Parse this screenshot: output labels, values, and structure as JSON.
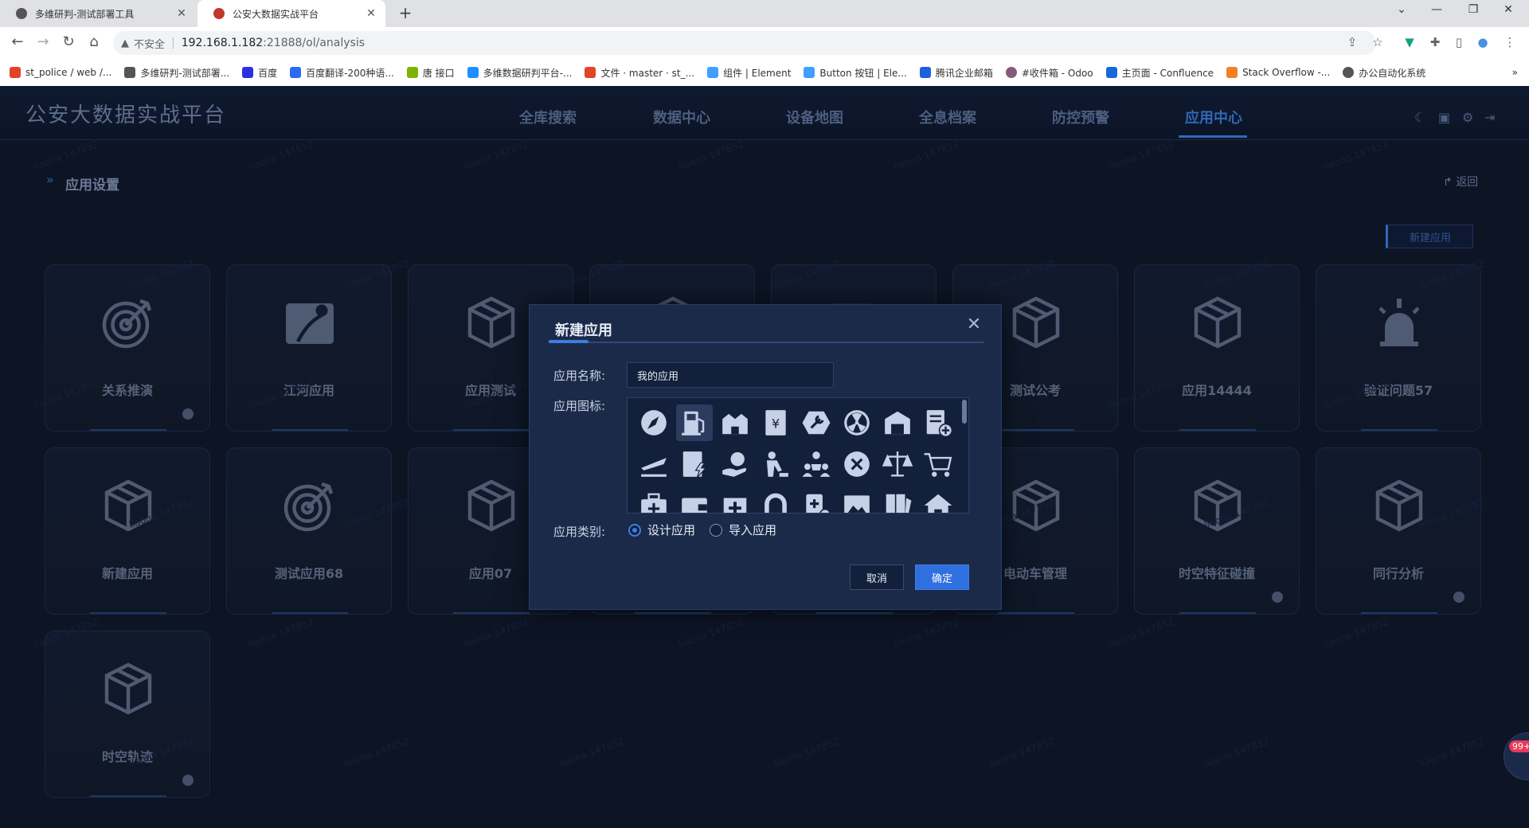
{
  "browser": {
    "tabs": [
      {
        "title": "多维研判-测试部署工具",
        "active": false
      },
      {
        "title": "公安大数据实战平台",
        "active": true
      }
    ],
    "new_tab_icon": "+",
    "address": {
      "insecure_label": "不安全",
      "host": "192.168.1.182",
      "path": ":21888/ol/analysis"
    },
    "bookmarks": [
      {
        "label": "st_police / web /...",
        "color": "#e24329"
      },
      {
        "label": "多维研判-测试部署...",
        "color": "#555555"
      },
      {
        "label": "百度",
        "color": "#2932e1"
      },
      {
        "label": "百度翻译-200种语...",
        "color": "#2a6bf2"
      },
      {
        "label": "唐 接口",
        "color": "#7cb305"
      },
      {
        "label": "多维数据研判平台-...",
        "color": "#1f8fff"
      },
      {
        "label": "文件 · master · st_...",
        "color": "#e24329"
      },
      {
        "label": "组件 | Element",
        "color": "#409eff"
      },
      {
        "label": "Button 按钮 | Ele...",
        "color": "#409eff"
      },
      {
        "label": "腾讯企业邮箱",
        "color": "#1e5fe0"
      },
      {
        "label": "#收件箱 - Odoo",
        "color": "#875a7b"
      },
      {
        "label": "主页面 - Confluence",
        "color": "#1868db"
      },
      {
        "label": "Stack Overflow -...",
        "color": "#f48024"
      },
      {
        "label": "办公自动化系统",
        "color": "#555555"
      }
    ]
  },
  "app": {
    "brand": "公安大数据实战平台",
    "nav": [
      {
        "label": "全库搜索",
        "active": false
      },
      {
        "label": "数据中心",
        "active": false
      },
      {
        "label": "设备地图",
        "active": false
      },
      {
        "label": "全息档案",
        "active": false
      },
      {
        "label": "防控预警",
        "active": false
      },
      {
        "label": "应用中心",
        "active": true
      }
    ],
    "page_title": "应用设置",
    "back_label": "返回",
    "new_app_button": "新建应用",
    "cards": [
      {
        "name": "关系推演",
        "icon": "target-icon",
        "badge": true
      },
      {
        "name": "江河应用",
        "icon": "map-icon",
        "badge": false
      },
      {
        "name": "应用测试",
        "icon": "box-icon",
        "badge": false
      },
      {
        "name": "",
        "icon": "box-icon",
        "badge": false
      },
      {
        "name": "",
        "icon": "edit-icon",
        "badge": false
      },
      {
        "name": "测试公考",
        "icon": "box-icon",
        "badge": false
      },
      {
        "name": "应用14444",
        "icon": "box-icon",
        "badge": false
      },
      {
        "name": "验证问题57",
        "icon": "alarm-icon",
        "badge": false
      },
      {
        "name": "新建应用",
        "icon": "box-icon",
        "badge": false
      },
      {
        "name": "测试应用68",
        "icon": "target-icon",
        "badge": false
      },
      {
        "name": "应用07",
        "icon": "box-icon",
        "badge": false
      },
      {
        "name": "",
        "icon": "box-icon",
        "badge": false
      },
      {
        "name": "",
        "icon": "box-icon",
        "badge": false
      },
      {
        "name": "电动车管理",
        "icon": "box-icon",
        "badge": false
      },
      {
        "name": "时空特征碰撞",
        "icon": "box-icon",
        "badge": true
      },
      {
        "name": "同行分析",
        "icon": "box-icon",
        "badge": true
      },
      {
        "name": "时空轨迹",
        "icon": "box-icon",
        "badge": true
      }
    ],
    "watermark": "liaona 147852",
    "chat_badge": "99+"
  },
  "modal": {
    "title": "新建应用",
    "name_label": "应用名称:",
    "name_value": "我的应用",
    "icon_label": "应用图标:",
    "icons": [
      "compass-icon",
      "gas-station-icon",
      "factory-icon",
      "yuan-document-icon",
      "wrench-icon",
      "radiation-icon",
      "garage-icon",
      "add-document-icon",
      "plane-icon",
      "power-document-icon",
      "hand-yuan-icon",
      "worker-icon",
      "team-icon",
      "close-circle-icon",
      "balance-scale-icon",
      "cart-icon",
      "medkit-icon",
      "wallet-icon",
      "hospital-icon",
      "magnet-icon",
      "ambulance-icon",
      "image-icon",
      "book-icon",
      "home-icon"
    ],
    "selected_icon": 1,
    "type_label": "应用类别:",
    "type_options": [
      {
        "label": "设计应用",
        "checked": true
      },
      {
        "label": "导入应用",
        "checked": false
      }
    ],
    "cancel_label": "取消",
    "ok_label": "确定"
  }
}
